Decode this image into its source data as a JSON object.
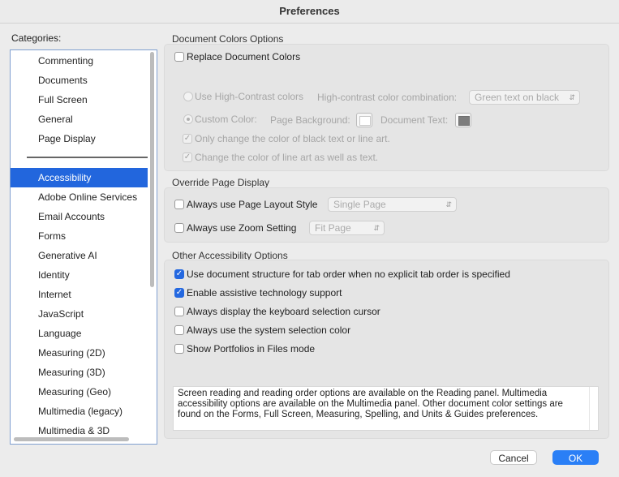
{
  "window": {
    "title": "Preferences"
  },
  "categories": {
    "label": "Categories:",
    "top_items": [
      "Commenting",
      "Documents",
      "Full Screen",
      "General",
      "Page Display"
    ],
    "items": [
      "Accessibility",
      "Adobe Online Services",
      "Email Accounts",
      "Forms",
      "Generative AI",
      "Identity",
      "Internet",
      "JavaScript",
      "Language",
      "Measuring (2D)",
      "Measuring (3D)",
      "Measuring (Geo)",
      "Multimedia (legacy)",
      "Multimedia & 3D"
    ],
    "selected": "Accessibility"
  },
  "doc_colors": {
    "title": "Document Colors Options",
    "replace_label": "Replace Document Colors",
    "high_contrast_label": "Use High-Contrast colors",
    "combination_label": "High-contrast color combination:",
    "combination_value": "Green text on black",
    "custom_label": "Custom Color:",
    "page_bg_label": "Page Background:",
    "doc_text_label": "Document Text:",
    "only_black_label": "Only change the color of black text or line art.",
    "line_art_label": "Change the color of line art as well as text."
  },
  "override": {
    "title": "Override Page Display",
    "layout_label": "Always use Page Layout Style",
    "layout_value": "Single Page",
    "zoom_label": "Always use Zoom Setting",
    "zoom_value": "Fit Page"
  },
  "other": {
    "title": "Other Accessibility Options",
    "options": [
      {
        "label": "Use document structure for tab order when no explicit tab order is specified",
        "checked": true
      },
      {
        "label": "Enable assistive technology support",
        "checked": true
      },
      {
        "label": "Always display the keyboard selection cursor",
        "checked": false
      },
      {
        "label": "Always use the system selection color",
        "checked": false
      },
      {
        "label": "Show Portfolios in Files mode",
        "checked": false
      }
    ]
  },
  "info_text": "Screen reading and reading order options are available on the Reading panel. Multimedia accessibility options are available on the Multimedia panel. Other document color settings are found on the Forms, Full Screen, Measuring, Spelling, and Units & Guides preferences.",
  "buttons": {
    "cancel": "Cancel",
    "ok": "OK"
  },
  "colors": {
    "accent": "#2266dd",
    "ok_button": "#2a7ff6"
  }
}
